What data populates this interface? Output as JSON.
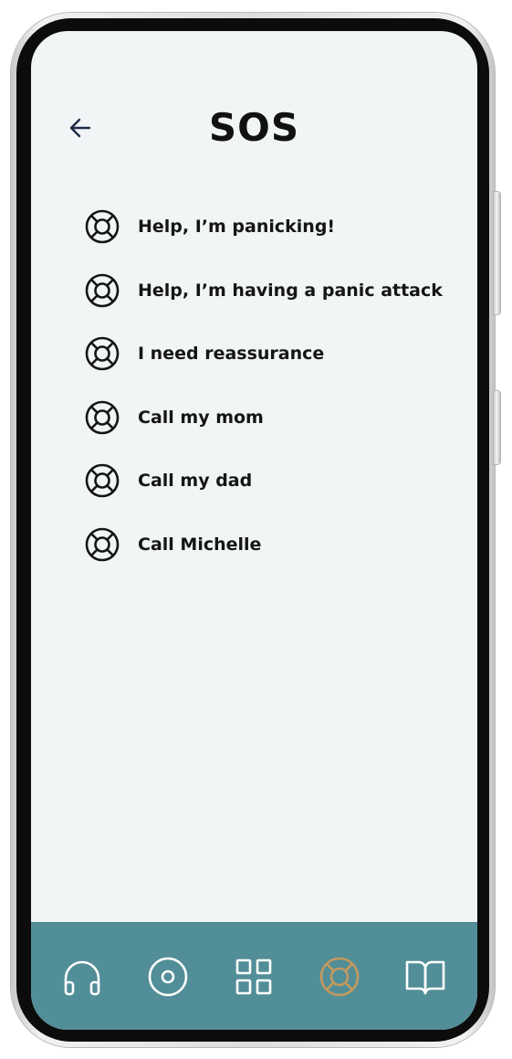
{
  "header": {
    "title": "SOS",
    "back_icon": "arrow-left-icon"
  },
  "sos_items": [
    {
      "label": "Help, I’m panicking!",
      "icon": "lifebuoy-icon"
    },
    {
      "label": "Help, I’m having a panic attack",
      "icon": "lifebuoy-icon"
    },
    {
      "label": "I need reassurance",
      "icon": "lifebuoy-icon"
    },
    {
      "label": "Call my mom",
      "icon": "lifebuoy-icon"
    },
    {
      "label": "Call my dad",
      "icon": "lifebuoy-icon"
    },
    {
      "label": "Call Michelle",
      "icon": "lifebuoy-icon"
    }
  ],
  "bottom_nav": {
    "items": [
      {
        "icon": "headphones-icon",
        "active": false
      },
      {
        "icon": "disc-icon",
        "active": false
      },
      {
        "icon": "grid-icon",
        "active": false
      },
      {
        "icon": "lifebuoy-icon",
        "active": true
      },
      {
        "icon": "book-icon",
        "active": false
      }
    ]
  },
  "colors": {
    "screen_background": "#f1f5f6",
    "nav_background": "#528e97",
    "nav_icon": "#ffffff",
    "nav_icon_active": "#c39a5e",
    "text": "#151515",
    "back_arrow": "#1f2a4a"
  }
}
